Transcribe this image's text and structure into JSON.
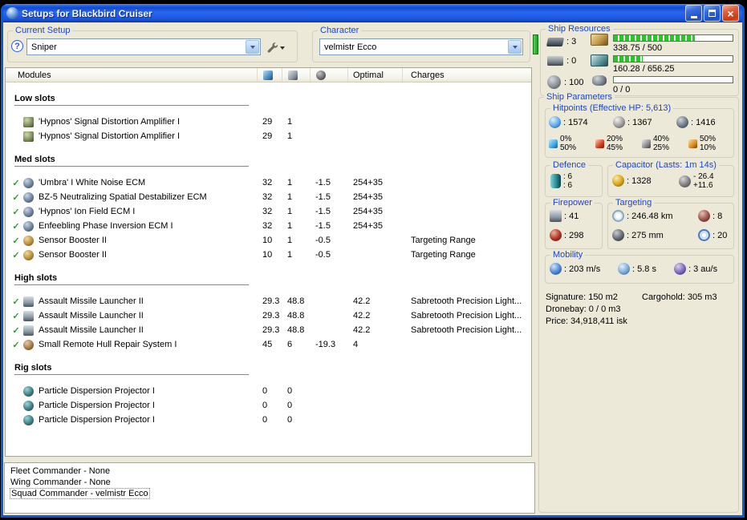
{
  "window": {
    "title": "Setups for Blackbird Cruiser"
  },
  "setup": {
    "group_label": "Current Setup",
    "value": "Sniper"
  },
  "character": {
    "group_label": "Character",
    "value": "velmistr Ecco"
  },
  "resources": {
    "group_label": "Ship Resources",
    "turrets": ": 3",
    "launchers": ": 0",
    "calibration": ": 100",
    "bars": [
      {
        "text": "338.75 / 500",
        "fill": 68
      },
      {
        "text": "160.28 / 656.25",
        "fill": 24
      },
      {
        "text": "0 / 0",
        "fill": 0
      }
    ]
  },
  "modules": {
    "header": {
      "col_modules": "Modules",
      "col_optimal": "Optimal",
      "col_charges": "Charges"
    },
    "sections": [
      {
        "name": "Low slots",
        "rows": [
          {
            "active": false,
            "icon": "sda",
            "name": "'Hypnos' Signal Distortion Amplifier I",
            "c1": "29",
            "c2": "1",
            "c3": "",
            "c4": "",
            "charges": ""
          },
          {
            "active": false,
            "icon": "sda",
            "name": "'Hypnos' Signal Distortion Amplifier I",
            "c1": "29",
            "c2": "1",
            "c3": "",
            "c4": "",
            "charges": ""
          }
        ]
      },
      {
        "name": "Med slots",
        "rows": [
          {
            "active": true,
            "icon": "ecm",
            "name": "'Umbra' I White Noise ECM",
            "c1": "32",
            "c2": "1",
            "c3": "-1.5",
            "c4": "254+35",
            "charges": ""
          },
          {
            "active": true,
            "icon": "ecm",
            "name": "BZ-5 Neutralizing Spatial Destabilizer ECM",
            "c1": "32",
            "c2": "1",
            "c3": "-1.5",
            "c4": "254+35",
            "charges": ""
          },
          {
            "active": true,
            "icon": "ecm",
            "name": "'Hypnos' Ion Field ECM I",
            "c1": "32",
            "c2": "1",
            "c3": "-1.5",
            "c4": "254+35",
            "charges": ""
          },
          {
            "active": true,
            "icon": "ecm",
            "name": "Enfeebling Phase Inversion ECM I",
            "c1": "32",
            "c2": "1",
            "c3": "-1.5",
            "c4": "254+35",
            "charges": ""
          },
          {
            "active": true,
            "icon": "booster",
            "name": "Sensor Booster II",
            "c1": "10",
            "c2": "1",
            "c3": "-0.5",
            "c4": "",
            "charges": "Targeting Range"
          },
          {
            "active": true,
            "icon": "booster",
            "name": "Sensor Booster II",
            "c1": "10",
            "c2": "1",
            "c3": "-0.5",
            "c4": "",
            "charges": "Targeting Range"
          }
        ]
      },
      {
        "name": "High slots",
        "rows": [
          {
            "active": true,
            "icon": "launcher",
            "name": "Assault Missile Launcher II",
            "c1": "29.3",
            "c2": "48.8",
            "c3": "",
            "c4": "42.2",
            "charges": "Sabretooth Precision Light..."
          },
          {
            "active": true,
            "icon": "launcher",
            "name": "Assault Missile Launcher II",
            "c1": "29.3",
            "c2": "48.8",
            "c3": "",
            "c4": "42.2",
            "charges": "Sabretooth Precision Light..."
          },
          {
            "active": true,
            "icon": "launcher",
            "name": "Assault Missile Launcher II",
            "c1": "29.3",
            "c2": "48.8",
            "c3": "",
            "c4": "42.2",
            "charges": "Sabretooth Precision Light..."
          },
          {
            "active": true,
            "icon": "hullrep",
            "name": "Small Remote Hull Repair System I",
            "c1": "45",
            "c2": "6",
            "c3": "-19.3",
            "c4": "4",
            "charges": ""
          }
        ]
      },
      {
        "name": "Rig slots",
        "rows": [
          {
            "active": false,
            "icon": "rig",
            "name": "Particle Dispersion Projector I",
            "c1": "0",
            "c2": "0",
            "c3": "",
            "c4": "",
            "charges": ""
          },
          {
            "active": false,
            "icon": "rig",
            "name": "Particle Dispersion Projector I",
            "c1": "0",
            "c2": "0",
            "c3": "",
            "c4": "",
            "charges": ""
          },
          {
            "active": false,
            "icon": "rig",
            "name": "Particle Dispersion Projector I",
            "c1": "0",
            "c2": "0",
            "c3": "",
            "c4": "",
            "charges": ""
          }
        ]
      }
    ]
  },
  "parameters": {
    "panel_label": "Ship Parameters",
    "hitpoints": {
      "label": "Hitpoints (Effective HP: 5,613)",
      "shield": ": 1574",
      "armor": ": 1367",
      "hull": ": 1416",
      "resists": [
        {
          "type": "em",
          "top": "0%",
          "bottom": "50%"
        },
        {
          "type": "thermal",
          "top": "20%",
          "bottom": "45%"
        },
        {
          "type": "kinetic",
          "top": "40%",
          "bottom": "25%"
        },
        {
          "type": "explosive",
          "top": "50%",
          "bottom": "10%"
        }
      ]
    },
    "defence": {
      "label": "Defence",
      "top": ": 6",
      "bottom": ": 6"
    },
    "capacitor": {
      "label": "Capacitor (Lasts: 1m 14s)",
      "amount": ": 1328",
      "delta_out": "- 26.4",
      "delta_in": "+11.6"
    },
    "firepower": {
      "label": "Firepower",
      "volley": ": 41",
      "dps": ": 298"
    },
    "targeting": {
      "label": "Targeting",
      "range": ": 246.48 km",
      "max_targets": ": 8",
      "scan_res": ": 275 mm",
      "sensor_str": ": 20"
    },
    "mobility": {
      "label": "Mobility",
      "speed": ": 203 m/s",
      "align": ": 5.8 s",
      "warp": ": 3 au/s"
    },
    "info": {
      "signature": "Signature: 150 m2",
      "cargohold": "Cargohold: 305 m3",
      "dronebay": "Dronebay: 0 / 0 m3",
      "price": "Price: 34,918,411 isk"
    }
  },
  "commanders": {
    "items": [
      {
        "text": "Fleet Commander - None",
        "selected": false
      },
      {
        "text": "Wing Commander - None",
        "selected": false
      },
      {
        "text": "Squad Commander - velmistr Ecco",
        "selected": true
      }
    ]
  }
}
